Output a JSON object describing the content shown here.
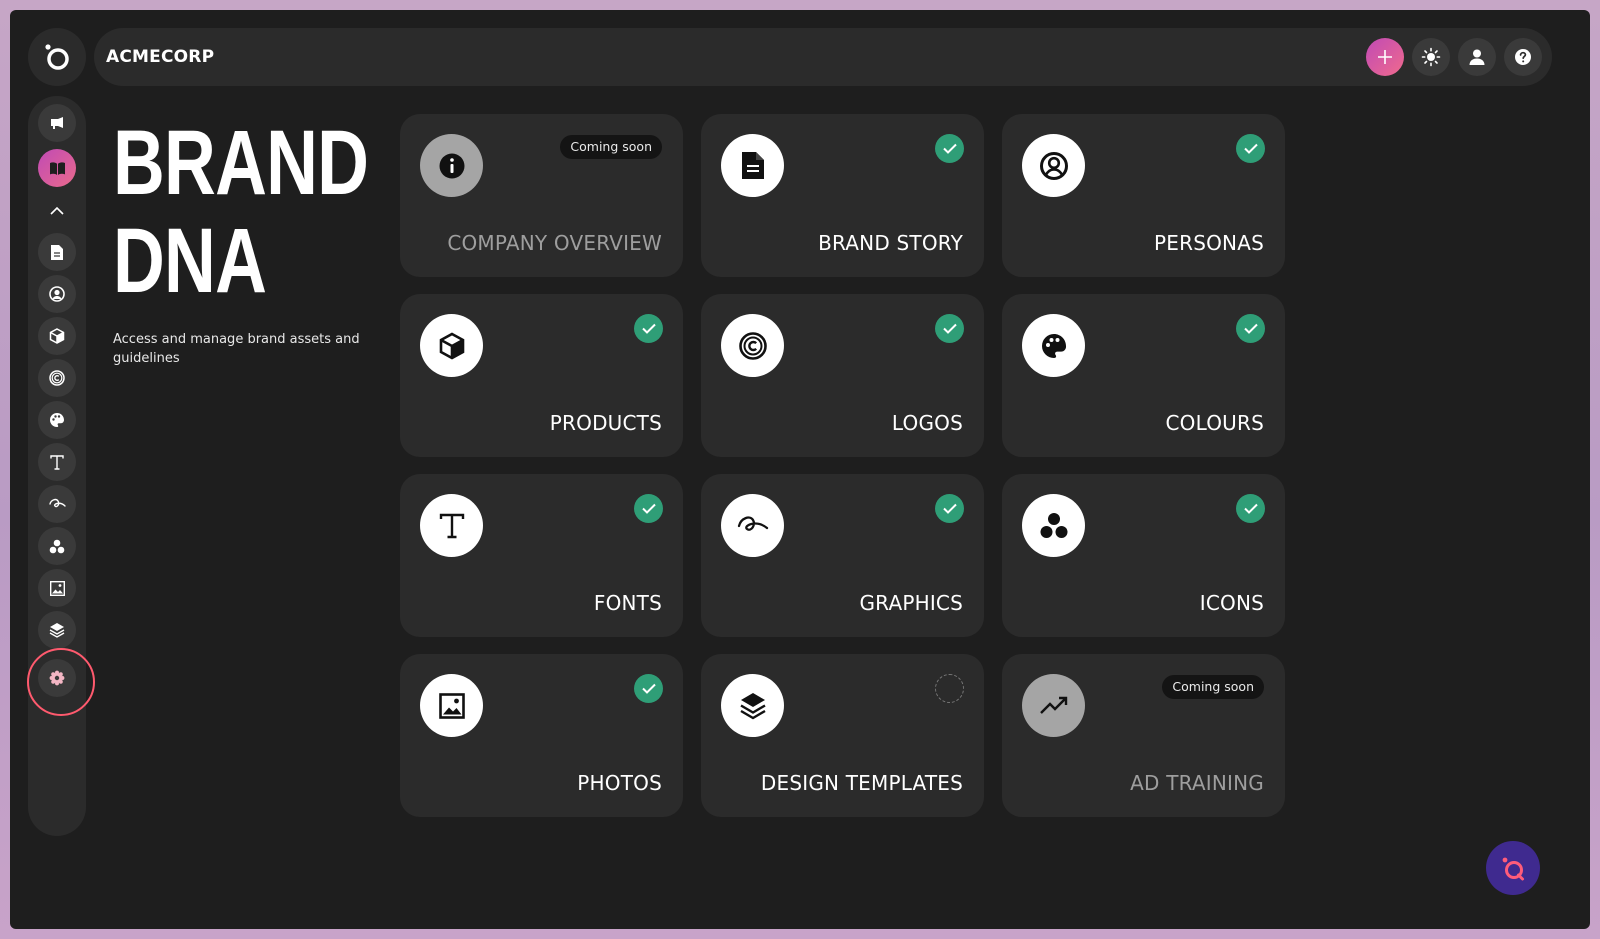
{
  "header": {
    "company": "ACMECORP"
  },
  "top_actions": [
    {
      "name": "add-button",
      "icon": "plus-icon"
    },
    {
      "name": "theme-toggle-button",
      "icon": "sun-icon"
    },
    {
      "name": "account-button",
      "icon": "user-icon"
    },
    {
      "name": "help-button",
      "icon": "question-icon"
    }
  ],
  "sidebar": {
    "items": [
      {
        "name": "sidebar-item-campaigns",
        "icon": "megaphone-icon"
      },
      {
        "name": "sidebar-item-brand-dna",
        "icon": "book-icon",
        "active": true
      },
      {
        "name": "sidebar-item-collapse",
        "icon": "chevron-up-icon"
      },
      {
        "name": "sidebar-item-brand-story",
        "icon": "document-icon"
      },
      {
        "name": "sidebar-item-personas",
        "icon": "persona-icon"
      },
      {
        "name": "sidebar-item-products",
        "icon": "cube-icon"
      },
      {
        "name": "sidebar-item-logos",
        "icon": "copyright-icon"
      },
      {
        "name": "sidebar-item-colours",
        "icon": "palette-icon"
      },
      {
        "name": "sidebar-item-fonts",
        "icon": "type-icon"
      },
      {
        "name": "sidebar-item-graphics",
        "icon": "squiggle-icon"
      },
      {
        "name": "sidebar-item-icons",
        "icon": "dots-icon"
      },
      {
        "name": "sidebar-item-photos",
        "icon": "image-icon"
      },
      {
        "name": "sidebar-item-design-templates",
        "icon": "layers-icon"
      },
      {
        "name": "sidebar-item-settings",
        "icon": "gear-icon"
      }
    ]
  },
  "hero": {
    "title_line1": "BRAND",
    "title_line2": "DNA",
    "subtitle": "Access and manage brand assets and guidelines"
  },
  "cards": [
    {
      "label": "COMPANY OVERVIEW",
      "icon": "info-icon",
      "status": "coming_soon",
      "badge": "Coming soon"
    },
    {
      "label": "BRAND STORY",
      "icon": "document-icon",
      "status": "complete"
    },
    {
      "label": "PERSONAS",
      "icon": "persona-icon",
      "status": "complete"
    },
    {
      "label": "PRODUCTS",
      "icon": "cube-icon",
      "status": "complete"
    },
    {
      "label": "LOGOS",
      "icon": "copyright-icon",
      "status": "complete"
    },
    {
      "label": "COLOURS",
      "icon": "palette-icon",
      "status": "complete"
    },
    {
      "label": "FONTS",
      "icon": "type-icon",
      "status": "complete"
    },
    {
      "label": "GRAPHICS",
      "icon": "squiggle-icon",
      "status": "complete"
    },
    {
      "label": "ICONS",
      "icon": "dots-icon",
      "status": "complete"
    },
    {
      "label": "PHOTOS",
      "icon": "image-icon",
      "status": "complete"
    },
    {
      "label": "DESIGN TEMPLATES",
      "icon": "layers-icon",
      "status": "pending"
    },
    {
      "label": "AD TRAINING",
      "icon": "trend-icon",
      "status": "coming_soon",
      "badge": "Coming soon"
    }
  ],
  "colors": {
    "accent_gradient_start": "#c04ab5",
    "accent_gradient_end": "#ea6a8c",
    "success": "#2f9e77",
    "highlight_ring": "#ff5a6e",
    "fab": "#3f2a8f"
  }
}
